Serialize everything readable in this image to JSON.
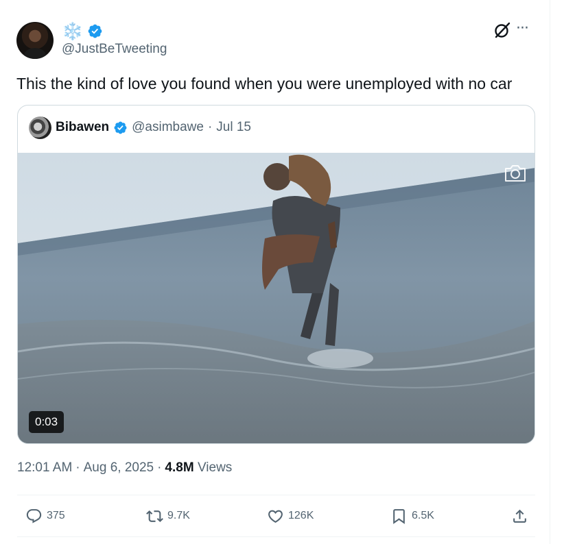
{
  "author": {
    "display_name": "❄️",
    "handle": "@JustBeTweeting",
    "verified": true
  },
  "tweet": {
    "text": "This the kind of love you found when you were unemployed with no car",
    "time": "12:01 AM",
    "date": "Aug 6, 2025",
    "views_count": "4.8M",
    "views_label": "Views"
  },
  "quote": {
    "name": "Bibawen",
    "handle": "@asimbawe",
    "separator": "·",
    "date": "Jul 15",
    "video_duration": "0:03"
  },
  "actions": {
    "replies": "375",
    "reposts": "9.7K",
    "likes": "126K",
    "bookmarks": "6.5K"
  },
  "icons": [
    "verified-badge-icon",
    "grok-icon",
    "more-icon",
    "camera-icon",
    "reply-icon",
    "repost-icon",
    "like-icon",
    "bookmark-icon",
    "share-icon"
  ],
  "colors": {
    "accent": "#1d9bf0",
    "text_primary": "#0f1419",
    "text_secondary": "#536471",
    "border": "#cfd9de"
  }
}
